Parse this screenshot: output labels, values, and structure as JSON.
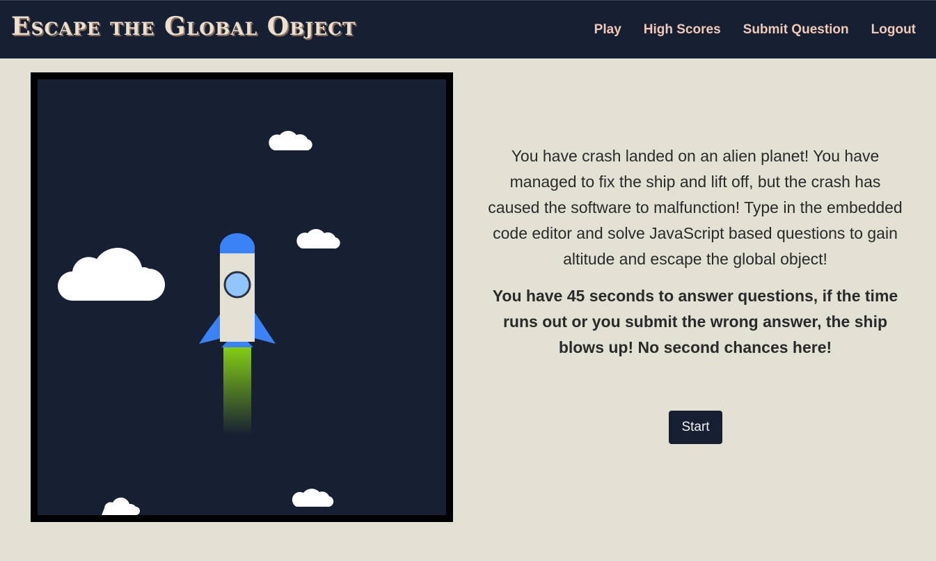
{
  "header": {
    "title": "Escape the Global Object",
    "nav": [
      {
        "label": "Play"
      },
      {
        "label": "High Scores"
      },
      {
        "label": "Submit Question"
      },
      {
        "label": "Logout"
      }
    ]
  },
  "intro": {
    "description": "You have crash landed on an alien planet! You have managed to fix the ship and lift off, but the crash has caused the software to malfunction! Type in the embedded code editor and solve JavaScript based questions to gain altitude and escape the global object!",
    "warning": "You have 45 seconds to answer questions, if the time runs out or you submit the wrong answer, the ship blows up! No second chances here!",
    "start_label": "Start"
  },
  "colors": {
    "navy": "#172032",
    "background": "#e3e0d4",
    "accent_nav": "#f0c9b8",
    "rocket_blue": "#3b82f6",
    "flame_green": "#84cc16"
  }
}
